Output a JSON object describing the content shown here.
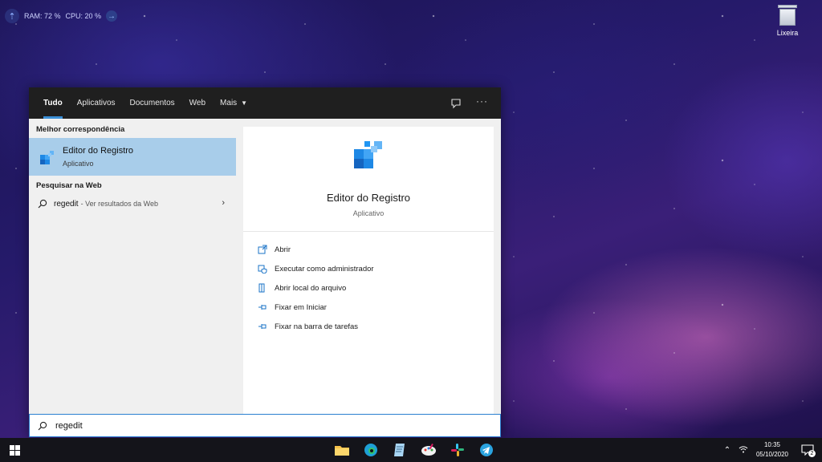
{
  "monitor": {
    "ram": "RAM: 72 %",
    "cpu": "CPU: 20 %"
  },
  "desktop": {
    "recycle_bin_label": "Lixeira"
  },
  "search_tabs": [
    {
      "label": "Tudo",
      "active": true
    },
    {
      "label": "Aplicativos"
    },
    {
      "label": "Documentos"
    },
    {
      "label": "Web"
    },
    {
      "label": "Mais"
    }
  ],
  "left": {
    "best_match_title": "Melhor correspondência",
    "best_match": {
      "name": "Editor do Registro",
      "type": "Aplicativo",
      "icon": "registry-editor-icon"
    },
    "web_title": "Pesquisar na Web",
    "web_result": {
      "query": "regedit",
      "suffix": "- Ver resultados da Web"
    }
  },
  "preview": {
    "name": "Editor do Registro",
    "type": "Aplicativo",
    "actions": [
      {
        "label": "Abrir",
        "icon": "open-icon"
      },
      {
        "label": "Executar como administrador",
        "icon": "run-as-admin-icon"
      },
      {
        "label": "Abrir local do arquivo",
        "icon": "file-location-icon"
      },
      {
        "label": "Fixar em Iniciar",
        "icon": "pin-icon"
      },
      {
        "label": "Fixar na barra de tarefas",
        "icon": "pin-taskbar-icon"
      }
    ]
  },
  "searchbox": {
    "value": "regedit"
  },
  "taskbar": {
    "apps": [
      "file-explorer-icon",
      "edge-icon",
      "notepad-icon",
      "paint-icon",
      "slack-icon",
      "telegram-icon"
    ],
    "clock_time": "10:35",
    "clock_date": "05/10/2020",
    "notification_count": "2"
  },
  "colors": {
    "accent": "#3b8fd6",
    "selection": "#a8cdea",
    "taskbar": "#14141a",
    "searchbar_dark": "#1f1f1f"
  }
}
